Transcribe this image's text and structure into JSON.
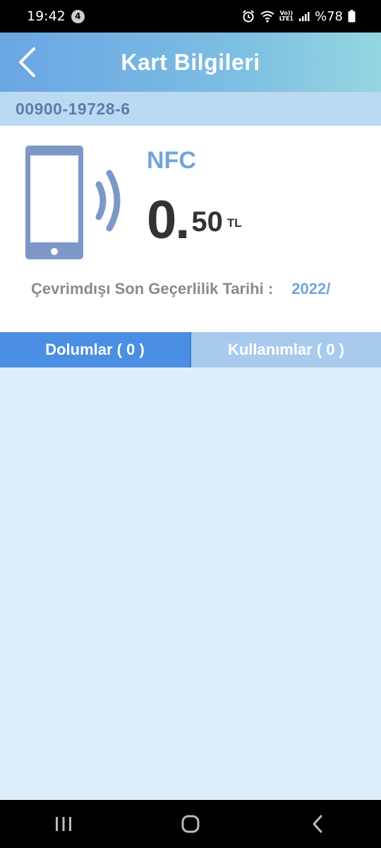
{
  "status_bar": {
    "time": "19:42",
    "notification_count": "4",
    "volte_label": "Vo))",
    "lte_label": "LTE1",
    "battery": "%78"
  },
  "header": {
    "title": "Kart Bilgileri"
  },
  "card": {
    "number": "00900-19728-6",
    "type": "NFC",
    "balance_int": "0",
    "balance_dot": ".",
    "balance_dec": "50",
    "currency": "TL",
    "expiry_label": "Çevrimdışı Son Geçerlilik Tarihi :",
    "expiry_value": "2022/"
  },
  "tabs": [
    {
      "label": "Dolumlar ( 0 )",
      "active": true
    },
    {
      "label": "Kullanımlar ( 0 )",
      "active": false
    }
  ],
  "colors": {
    "header_start": "#6aa6e3",
    "header_end": "#94d6e0",
    "accent": "#73a5db",
    "tab_active": "#4a8fe3",
    "tab_inactive": "#a8cbed",
    "content_bg": "#e0eefb"
  },
  "icons": {
    "back": "chevron-left-icon",
    "phone": "phone-icon",
    "nfc_waves": "nfc-waves-icon",
    "nav_recents": "recents-icon",
    "nav_home": "home-icon",
    "nav_back": "back-icon"
  }
}
